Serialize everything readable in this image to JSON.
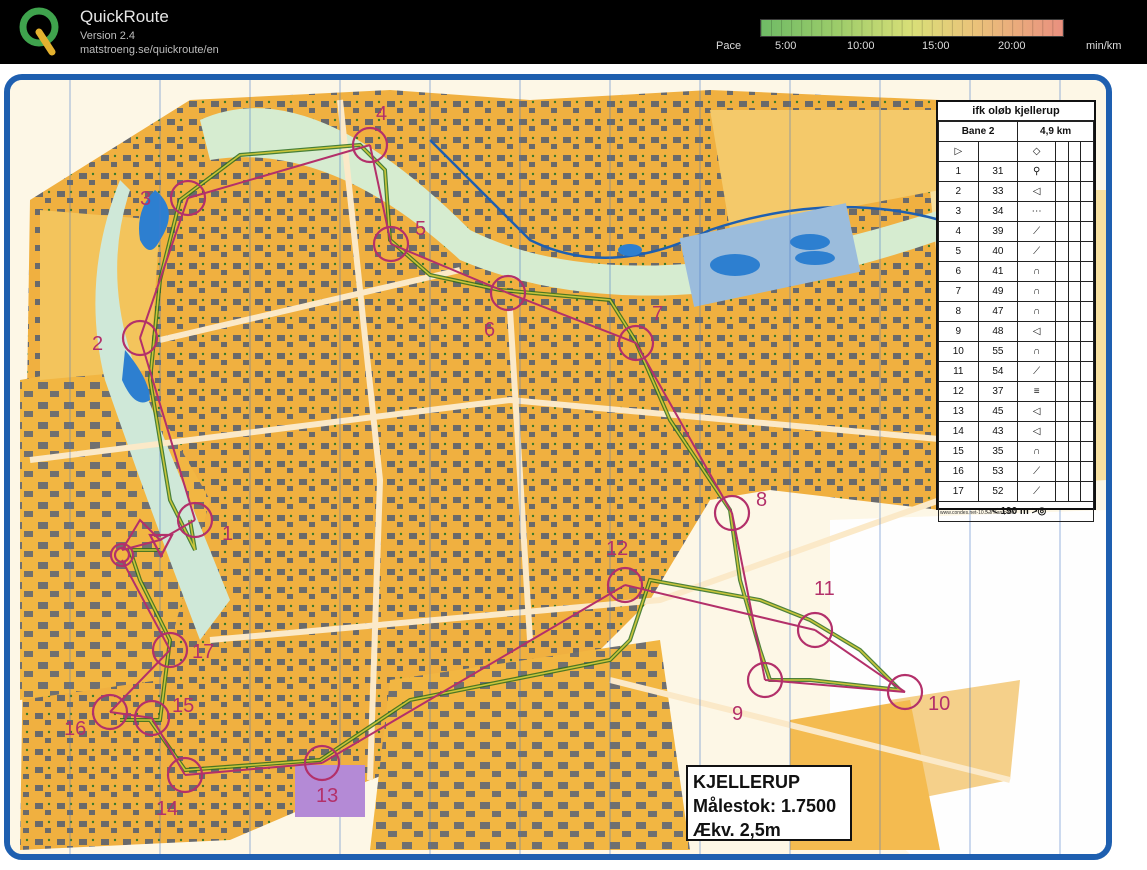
{
  "header": {
    "app_name": "QuickRoute",
    "version": "Version 2.4",
    "url": "matstroeng.se/quickroute/en",
    "logo_icon": "quickroute-q-logo-icon"
  },
  "pace_scale": {
    "label": "Pace",
    "ticks": [
      "5:00",
      "10:00",
      "15:00",
      "20:00"
    ],
    "unit": "min/km",
    "colors": [
      "#6fbb66",
      "#d9df78",
      "#e9907f"
    ]
  },
  "map": {
    "frame_color": "#1e5fb0",
    "course_color": "#b3306a",
    "route_colors": [
      "#2f6c1c",
      "#c9c53a"
    ],
    "controls": [
      "1",
      "2",
      "3",
      "4",
      "5",
      "6",
      "7",
      "8",
      "9",
      "10",
      "11",
      "12",
      "13",
      "14",
      "15",
      "16",
      "17"
    ]
  },
  "description_card": {
    "title": "ifk oløb kjellerup",
    "course": "Bane 2",
    "length": "4,9 km",
    "rows": [
      {
        "n": "1",
        "code": "31"
      },
      {
        "n": "2",
        "code": "33"
      },
      {
        "n": "3",
        "code": "34"
      },
      {
        "n": "4",
        "code": "39"
      },
      {
        "n": "5",
        "code": "40"
      },
      {
        "n": "6",
        "code": "41"
      },
      {
        "n": "7",
        "code": "49"
      },
      {
        "n": "8",
        "code": "47"
      },
      {
        "n": "9",
        "code": "48"
      },
      {
        "n": "10",
        "code": "55"
      },
      {
        "n": "11",
        "code": "54"
      },
      {
        "n": "12",
        "code": "37"
      },
      {
        "n": "13",
        "code": "45"
      },
      {
        "n": "14",
        "code": "43"
      },
      {
        "n": "15",
        "code": "35"
      },
      {
        "n": "16",
        "code": "53"
      },
      {
        "n": "17",
        "code": "52"
      }
    ],
    "finish_distance": "190 m",
    "credit": "www.condes.net-10.5.3 Karup OK"
  },
  "info_box": {
    "line1": "KJELLERUP",
    "line2": "Målestok: 1.7500",
    "line3": "Ækv. 2,5m"
  }
}
